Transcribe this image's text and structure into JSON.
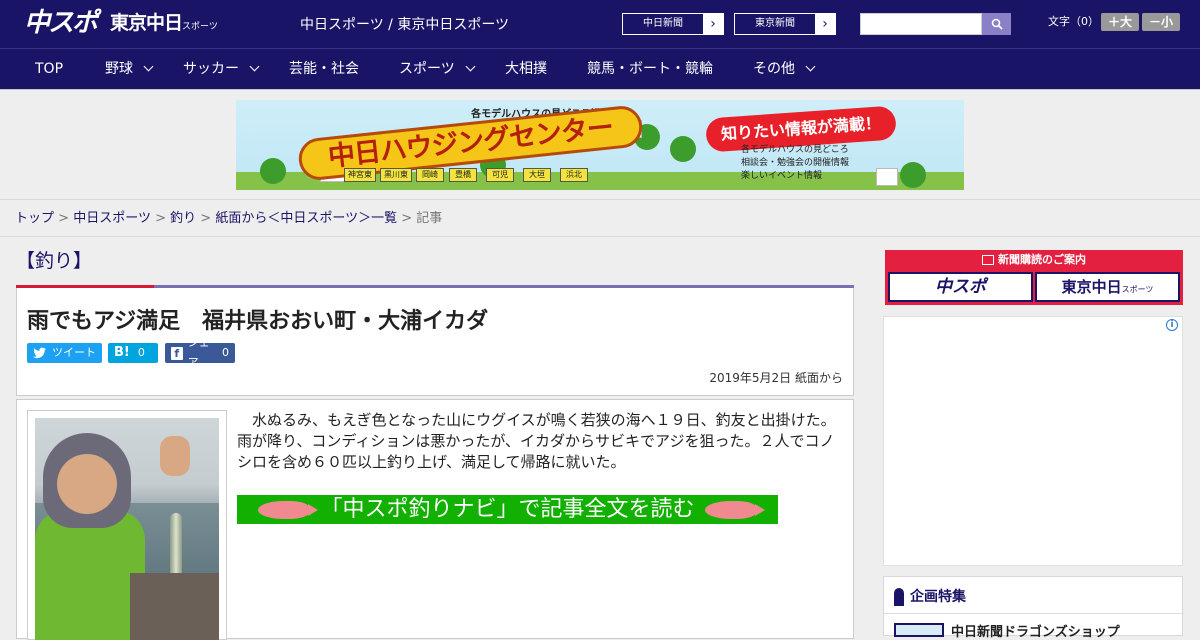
{
  "header": {
    "logo_chuspo": "中スポ",
    "logo_tokyo": "東京中日",
    "logo_tokyo_sub": "スポーツ",
    "tagline": "中日スポーツ / 東京中日スポーツ",
    "btn_chunichi": "中日新聞",
    "btn_tokyo": "東京新聞",
    "search_placeholder": "",
    "font_size_label": "文字（0）",
    "font_large": "＋大",
    "font_small": "－小"
  },
  "nav": {
    "items": [
      {
        "label": "TOP",
        "dropdown": false
      },
      {
        "label": "野球",
        "dropdown": true
      },
      {
        "label": "サッカー",
        "dropdown": true
      },
      {
        "label": "芸能・社会",
        "dropdown": false
      },
      {
        "label": "スポーツ",
        "dropdown": true
      },
      {
        "label": "大相撲",
        "dropdown": false
      },
      {
        "label": "競馬・ボート・競輪",
        "dropdown": false
      },
      {
        "label": "その他",
        "dropdown": true
      }
    ]
  },
  "banner": {
    "top_text": "各モデルハウスの見どころ満載！",
    "title": "中日ハウジングセンター",
    "speech": "知りたい情報が満載！",
    "info": [
      "各モデルハウスの見どころ",
      "相談会・勉強会の開催情報",
      "楽しいイベント情報"
    ],
    "cities": [
      "神宮東",
      "黒川東",
      "岡崎",
      "豊橋",
      "可児",
      "大垣",
      "浜北"
    ]
  },
  "breadcrumb": {
    "items": [
      "トップ",
      "中日スポーツ",
      "釣り",
      "紙面から＜中日スポーツ＞一覧"
    ],
    "current": "記事",
    "sep": ">"
  },
  "article": {
    "section": "【釣り】",
    "title": "雨でもアジ満足　福井県おおい町・大浦イカダ",
    "share": {
      "tweet": "ツイート",
      "hatena_label": "B!",
      "hatena_count": "0",
      "fb_label": "シェア",
      "fb_count": "0"
    },
    "date": "2019年5月2日 紙面から",
    "body": "水ぬるみ、もえぎ色となった山にウグイスが鳴く若狭の海へ１９日、釣友と出掛けた。雨が降り、コンディションは悪かったが、イカダからサビキでアジを狙った。２人でコノシロを含め６０匹以上釣り上げ、満足して帰路に就いた。",
    "navi_link": "「中スポ釣りナビ」で記事全文を読む"
  },
  "sidebar": {
    "subscribe_title": "新聞購読のご案内",
    "subscribe_chuspo": "中スポ",
    "subscribe_tokyo": "東京中日",
    "subscribe_tokyo_sub": "スポーツ",
    "ad_info": "i",
    "feature_title": "企画特集",
    "feature_item": "中日新聞ドラゴンズショップ"
  },
  "colors": {
    "header_bg": "#1a1466",
    "accent_red": "#d71a3a",
    "accent_purple": "#7a6eb4",
    "navi_green": "#12b000"
  }
}
